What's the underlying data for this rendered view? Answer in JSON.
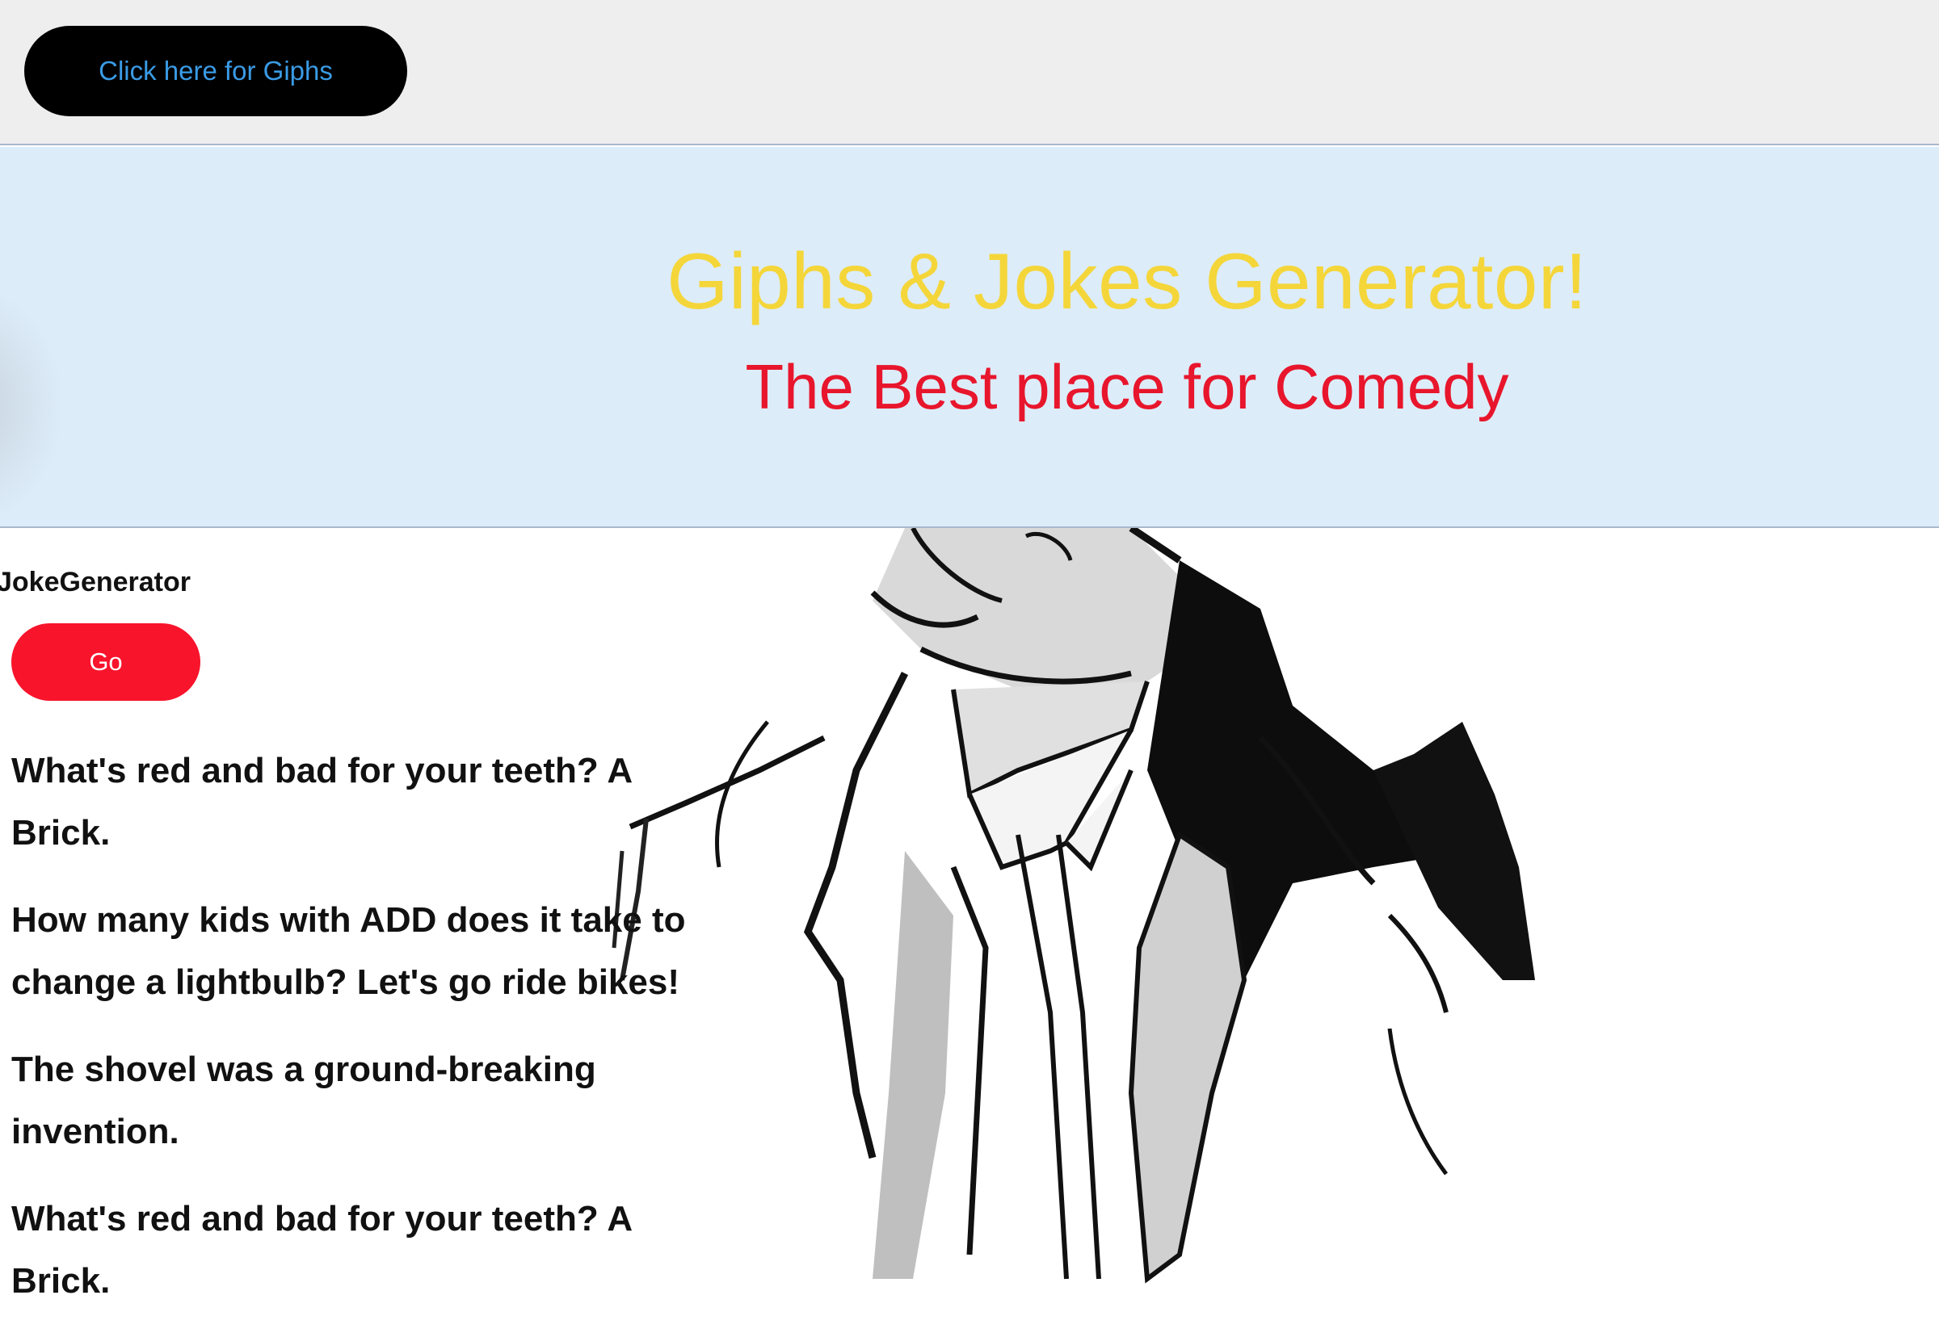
{
  "colors": {
    "accent_blue": "#3a9be5",
    "title_yellow": "#f4d63a",
    "subtitle_red": "#e8162c",
    "go_red": "#f8142b"
  },
  "topbar": {
    "giphs_button_label": "Click here for Giphs"
  },
  "hero": {
    "title": "Giphs & Jokes Generator!",
    "subtitle": "The Best place for Comedy"
  },
  "joke_section": {
    "label": "JokeGenerator",
    "go_button_label": "Go",
    "jokes": [
      "What's red and bad for your teeth? A Brick.",
      "How many kids with ADD does it take to change a lightbulb? Let's go ride bikes!",
      "The shovel was a ground-breaking invention.",
      "What's red and bad for your teeth? A Brick."
    ]
  },
  "background_image": {
    "icon": "cartoon-man-illustration"
  }
}
